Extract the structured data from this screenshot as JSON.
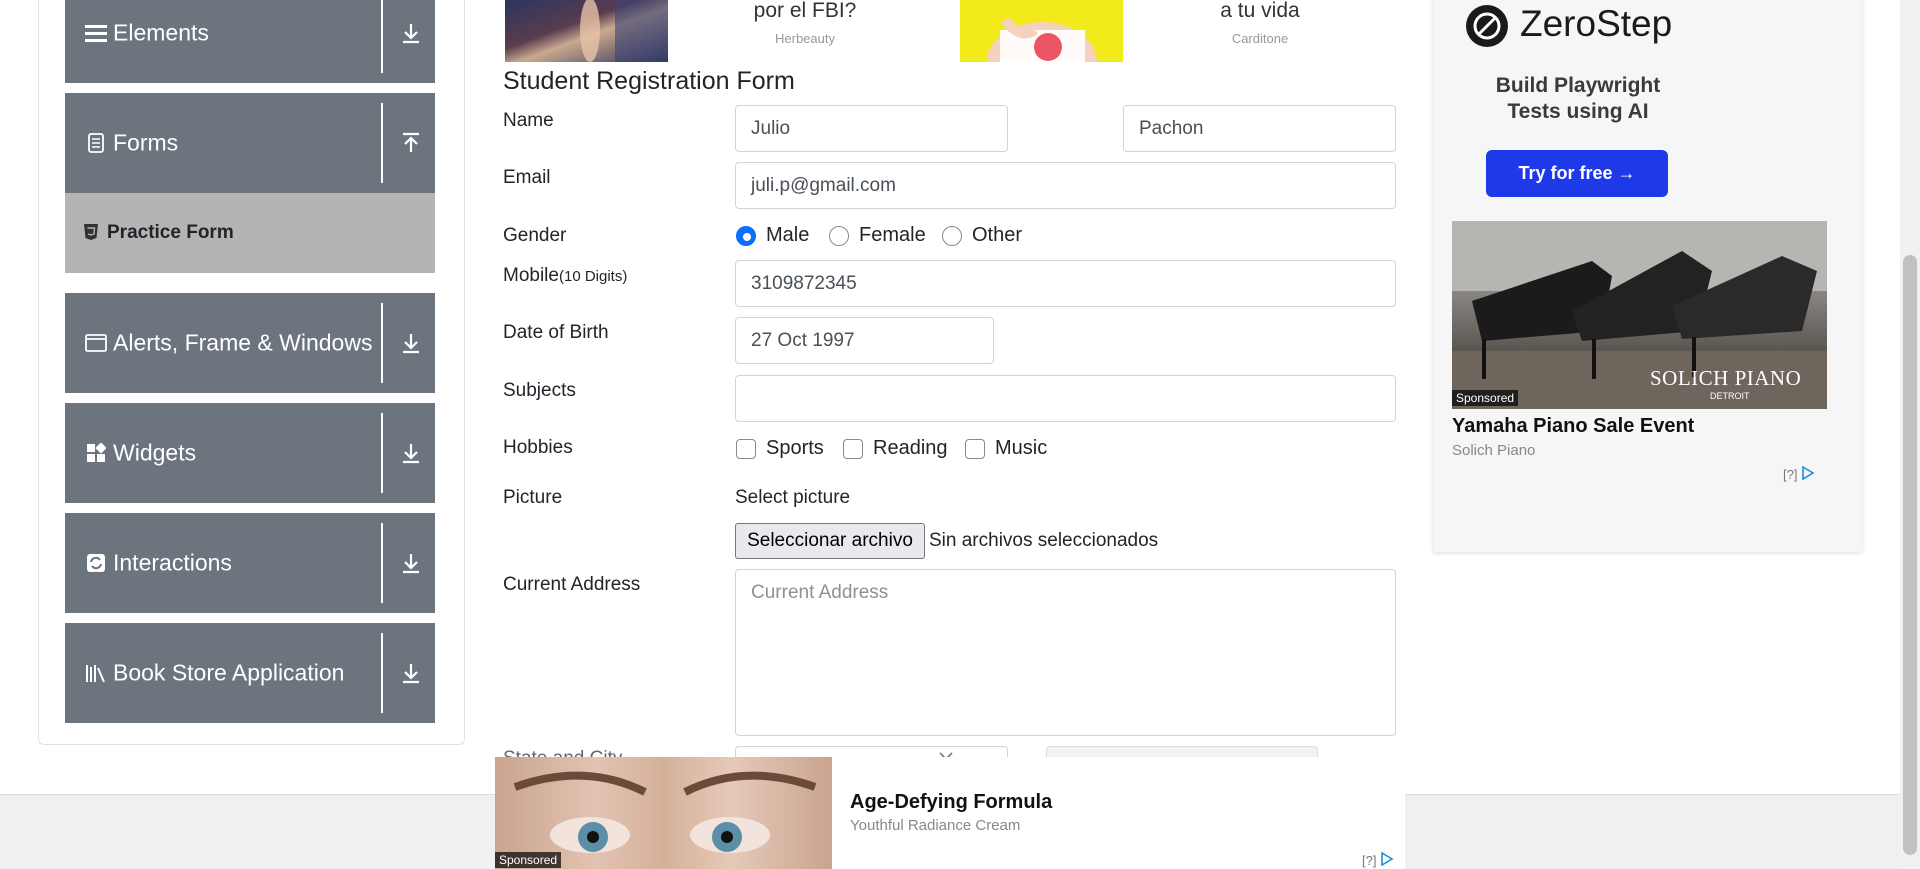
{
  "sidebar": {
    "groups": [
      {
        "label": "Elements",
        "icon": "hamburger-icon",
        "arrow": "download-arrow-icon"
      },
      {
        "label": "Forms",
        "icon": "document-icon",
        "arrow": "upload-arrow-icon"
      },
      {
        "label": "Alerts, Frame & Windows",
        "icon": "window-icon",
        "arrow": "download-arrow-icon"
      },
      {
        "label": "Widgets",
        "icon": "widgets-icon",
        "arrow": "download-arrow-icon"
      },
      {
        "label": "Interactions",
        "icon": "refresh-icon",
        "arrow": "download-arrow-icon"
      },
      {
        "label": "Book Store Application",
        "icon": "library-icon",
        "arrow": "download-arrow-icon"
      }
    ],
    "active_item": {
      "label": "Practice Form",
      "icon": "html5-icon"
    }
  },
  "top_ads": [
    {
      "text": "por el FBI?",
      "source": "Herbeauty"
    },
    {
      "text": "a tu vida",
      "source": "Carditone"
    }
  ],
  "form": {
    "title": "Student Registration Form",
    "name_label": "Name",
    "first_name": "Julio",
    "last_name": "Pachon",
    "email_label": "Email",
    "email": "juli.p@gmail.com",
    "gender_label": "Gender",
    "gender_options": [
      "Male",
      "Female",
      "Other"
    ],
    "gender_selected": "Male",
    "mobile_label": "Mobile",
    "mobile_hint": "(10 Digits)",
    "mobile": "3109872345",
    "dob_label": "Date of Birth",
    "dob": "27 Oct 1997",
    "subjects_label": "Subjects",
    "subjects": "",
    "hobbies_label": "Hobbies",
    "hobbies": [
      "Sports",
      "Reading",
      "Music"
    ],
    "picture_label": "Picture",
    "select_picture": "Select picture",
    "file_button": "Seleccionar archivo",
    "file_status": "Sin archivos seleccionados",
    "address_label": "Current Address",
    "address_placeholder": "Current Address",
    "state_city_label": "State and City"
  },
  "right_ad": {
    "brand": "ZeroStep",
    "headline": "Build Playwright Tests using AI",
    "cta": "Try for free →",
    "sponsored": "Sponsored",
    "piano_brand": "SOLICH PIANO",
    "piano_city": "DETROIT",
    "title": "Yamaha Piano Sale Event",
    "source": "Solich Piano",
    "adchoice": "[?]"
  },
  "bottom_ad": {
    "sponsored": "Sponsored",
    "title": "Age-Defying Formula",
    "subtitle": "Youthful Radiance Cream",
    "adchoice": "[?]"
  },
  "colors": {
    "sidebar_bg": "#6c757d",
    "active_item_bg": "#b4b4b4",
    "radio_accent": "#0d6efd",
    "cta_blue": "#1d39e8"
  }
}
